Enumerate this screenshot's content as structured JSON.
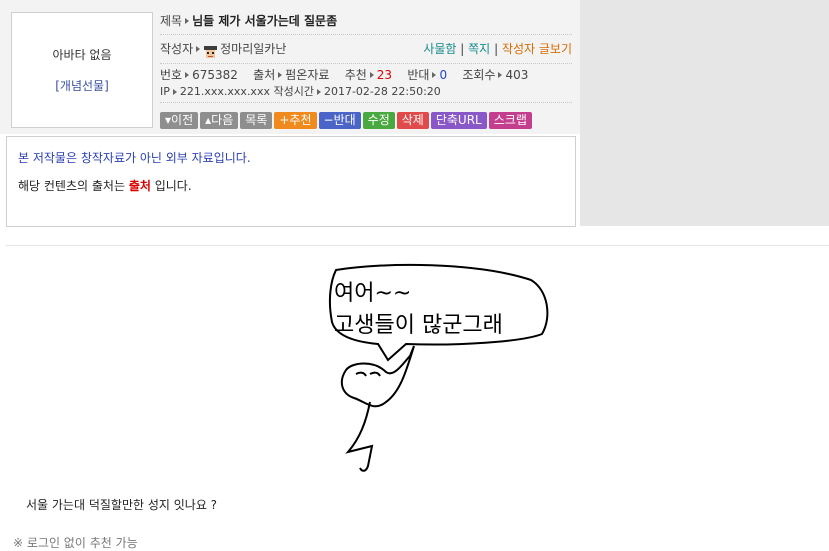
{
  "avatar": {
    "no_avatar": "아바타 없음",
    "gift_link": "[개념선물]"
  },
  "post": {
    "title_label": "제목",
    "title": "님들 제가 서울가는데 질문좀",
    "author_label": "작성자",
    "author": "정마리일카난",
    "links": {
      "profile": "사물함",
      "message": "쪽지",
      "author_posts": "작성자 글보기",
      "sep": "|"
    },
    "number_label": "번호",
    "number": "675382",
    "source_label": "출처",
    "source": "펌온자료",
    "recommend_label": "추천",
    "recommend": "23",
    "oppose_label": "반대",
    "oppose": "0",
    "views_label": "조회수",
    "views": "403",
    "ip_label": "IP",
    "ip": "221.xxx.xxx.xxx",
    "time_label": "작성시간",
    "time": "2017-02-28 22:50:20"
  },
  "buttons": {
    "prev": "이전",
    "next": "다음",
    "list": "목록",
    "recommend": "추천",
    "oppose": "반대",
    "edit": "수정",
    "delete": "삭제",
    "short_url": "단축URL",
    "scrap": "스크랩"
  },
  "notice": {
    "line1": "본 저작물은 창작자료가 아닌 외부 자료입니다.",
    "line2_pre": "해당 컨텐츠의 출처는 ",
    "line2_source": "출처",
    "line2_post": " 입니다."
  },
  "drawing": {
    "bubble_line1": "여어~~",
    "bubble_line2": "고생들이 많군그래"
  },
  "body": {
    "question": "서울 가는대 덕질할만한 성지 잇나요 ?",
    "login_note": "※ 로그인 없이 추천 가능"
  },
  "colors": {
    "teal": "#1a8c8c",
    "orange": "#d96b00",
    "red": "#dd0000",
    "blue": "#2244cc"
  }
}
